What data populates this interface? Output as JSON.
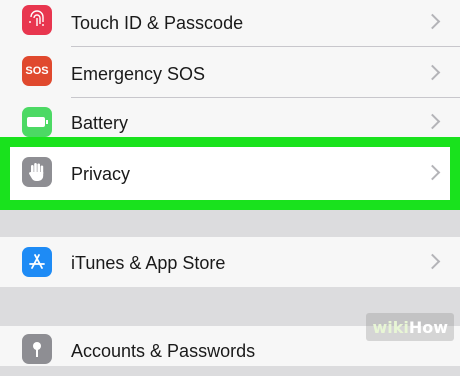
{
  "settings": {
    "rows_group1": [
      {
        "label": "Touch ID & Passcode",
        "icon": "fingerprint-icon",
        "icon_color": "#e8364f"
      },
      {
        "label": "Emergency SOS",
        "icon": "sos-icon",
        "icon_text": "SOS",
        "icon_color": "#e0492e"
      },
      {
        "label": "Battery",
        "icon": "battery-icon",
        "icon_color": "#4cd964"
      },
      {
        "label": "Privacy",
        "icon": "hand-icon",
        "icon_color": "#8e8e93"
      }
    ],
    "rows_group2": [
      {
        "label": "iTunes & App Store",
        "icon": "app-store-icon",
        "icon_color": "#1e8bf5"
      }
    ],
    "rows_group3": [
      {
        "label": "Accounts & Passwords",
        "icon": "key-icon",
        "icon_color": "#8e8e93"
      }
    ]
  },
  "highlight_color": "#19e21d",
  "watermark": {
    "wiki": "wiki",
    "how": "How"
  }
}
